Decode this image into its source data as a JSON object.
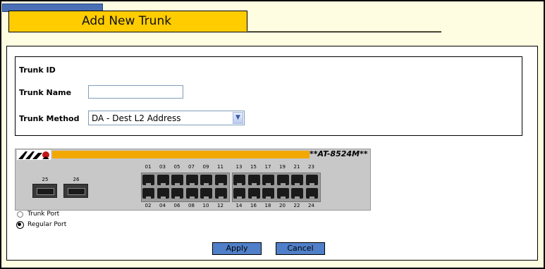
{
  "header": {
    "title": "Add New Trunk"
  },
  "form": {
    "trunk_id_label": "Trunk ID",
    "trunk_name_label": "Trunk Name",
    "trunk_name_value": "",
    "trunk_method_label": "Trunk Method",
    "trunk_method_value": "DA - Dest L2 Address"
  },
  "switch": {
    "model": "**AT-8524M**",
    "sfp_ports": [
      "25",
      "26"
    ],
    "top_ports": [
      "01",
      "03",
      "05",
      "07",
      "09",
      "11",
      "13",
      "15",
      "17",
      "19",
      "21",
      "23"
    ],
    "bottom_ports": [
      "02",
      "04",
      "06",
      "08",
      "10",
      "12",
      "14",
      "16",
      "18",
      "20",
      "22",
      "24"
    ]
  },
  "legend": {
    "trunk_port_label": "Trunk Port",
    "regular_port_label": "Regular Port",
    "selected": "Regular Port"
  },
  "buttons": {
    "apply": "Apply",
    "cancel": "Cancel"
  },
  "colors": {
    "title_tab": "#ffcc00",
    "button": "#4f7fc8",
    "background": "#fffde1"
  }
}
